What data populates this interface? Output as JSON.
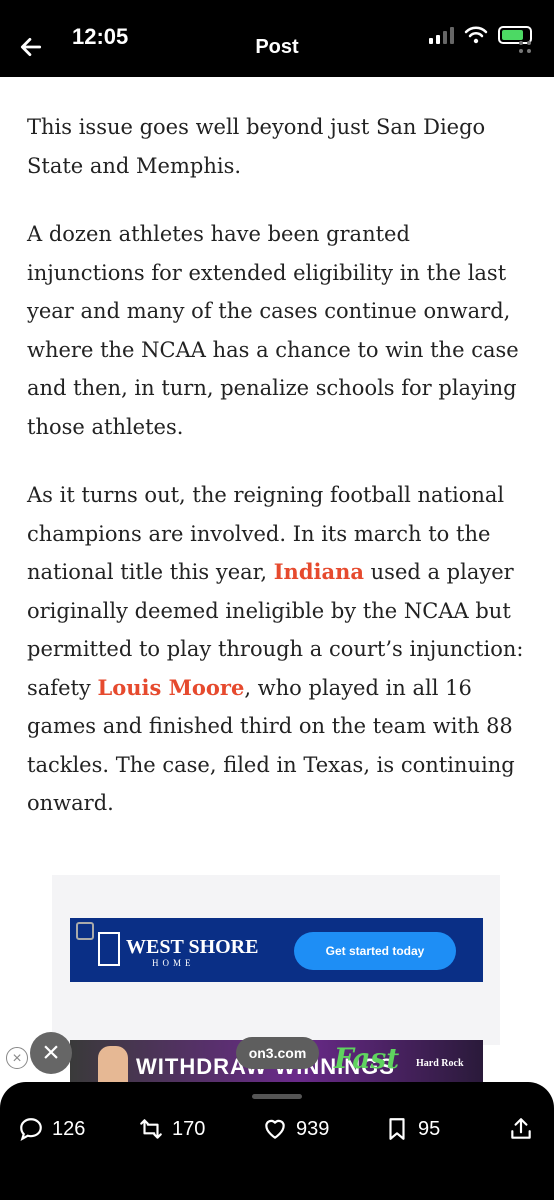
{
  "status_bar": {
    "time": "12:05"
  },
  "header": {
    "title": "Post"
  },
  "article": {
    "p1": "This issue goes well beyond just San Diego State and Memphis.",
    "p2": "A dozen athletes have been granted injunctions for extended eligibility in the last year and many of the cases continue onward, where the NCAA has a chance to win the case and then, in turn, penalize schools for playing those athletes.",
    "p3_a": "As it turns out, the reigning football national champions are involved. In its march to the national title this year, ",
    "p3_link1": "Indiana",
    "p3_b": " used a player originally deemed ineligible by the NCAA but permitted to play through a court’s injunction: safety ",
    "p3_link2": "Louis Moore",
    "p3_c": ", who played in all 16 games and finished third on the team with 88 tackles. The case, filed in Texas, is continuing onward."
  },
  "ads": {
    "ad1": {
      "brand": "WEST SHORE",
      "brand_sub": "HOME",
      "cta": "Get started today"
    },
    "ad2": {
      "headline": "WITHDRAW WINNINGS",
      "accent": "Fast",
      "brand": "Hard Rock"
    },
    "source_pill": "on3.com"
  },
  "actions": {
    "replies": "126",
    "reposts": "170",
    "likes": "939",
    "bookmarks": "95"
  },
  "colors": {
    "link": "#e64a2e",
    "cta": "#1e8ef5",
    "ad_bg": "#0a2f86"
  }
}
